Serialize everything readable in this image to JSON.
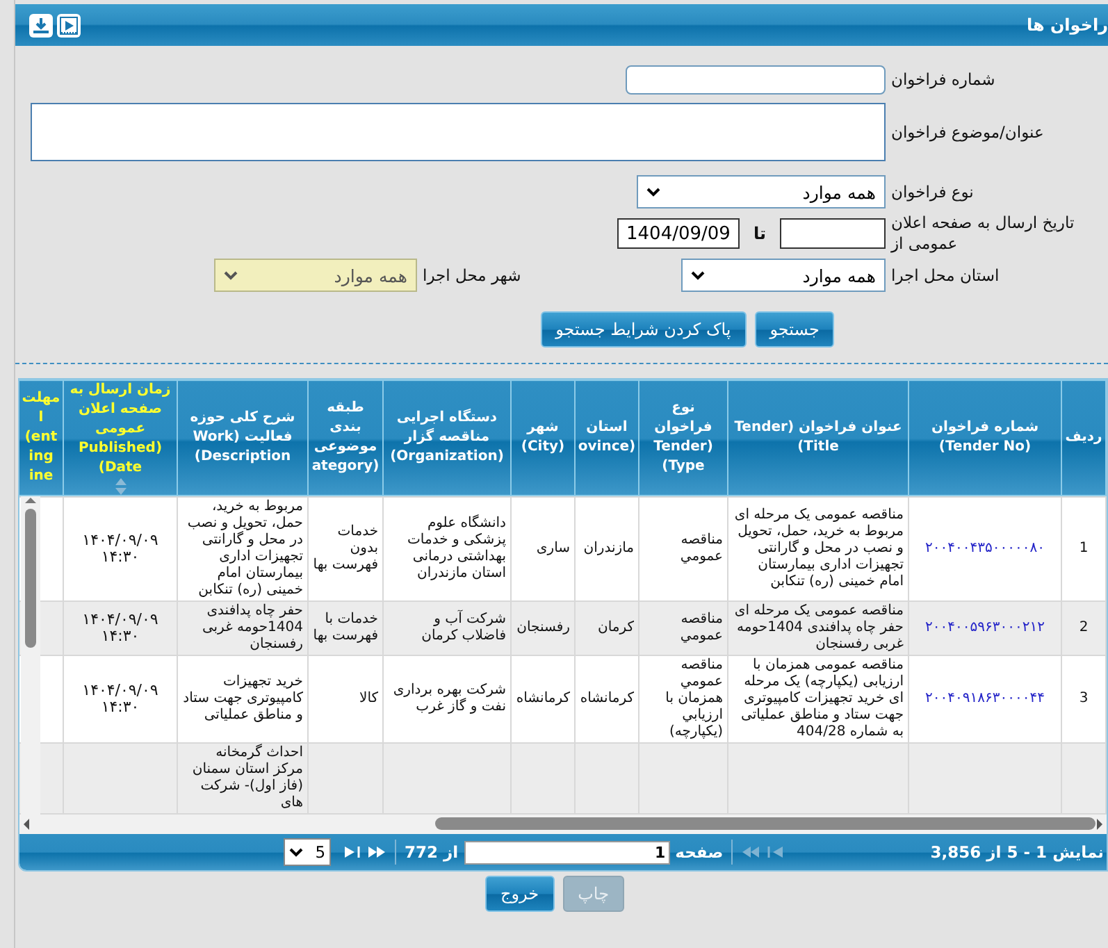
{
  "header": {
    "title": "راخوان ها",
    "icons": [
      {
        "kind": "download"
      },
      {
        "kind": "video"
      }
    ]
  },
  "form": {
    "tender_no": {
      "label": "شماره فراخوان"
    },
    "subject": {
      "label": "عنوان/موضوع فراخوان"
    },
    "type": {
      "label": "نوع فراخوان",
      "value": "همه موارد"
    },
    "date": {
      "label": "تاریخ ارسال به صفحه اعلان عمومی از",
      "to_label": "تا",
      "to_value": "1404/09/09"
    },
    "province": {
      "label": "استان محل اجرا",
      "value": "همه موارد"
    },
    "city": {
      "label": "شهر محل اجرا",
      "value": "همه موارد",
      "disabled": true
    },
    "buttons": [
      {
        "label": "جستجو"
      },
      {
        "label": "پاک کردن شرایط جستجو"
      }
    ]
  },
  "table": {
    "columns": [
      {
        "label": "ردیف",
        "highlight": false,
        "sortable": false
      },
      {
        "label": "شماره فراخوان\n(Tender No)",
        "highlight": false,
        "sortable": false
      },
      {
        "label": "عنوان فراخوان (Tender\n(Title",
        "highlight": false,
        "sortable": false
      },
      {
        "label": "نوع\nفراخوان\nTender)\n(Type",
        "highlight": false,
        "sortable": false
      },
      {
        "label": "استان\novince)",
        "highlight": false,
        "sortable": false
      },
      {
        "label": "شهر\n(City)",
        "highlight": false,
        "sortable": false
      },
      {
        "label": "دستگاه اجرایی\nمناقصه گزار\n(Organization)",
        "highlight": false,
        "sortable": false
      },
      {
        "label": "طبقه\nبندی\nموضوعی\nategory)",
        "highlight": false,
        "sortable": false
      },
      {
        "label": "شرح کلی حوزه\nفعالیت (Work\n(Description",
        "highlight": false,
        "sortable": false
      },
      {
        "label": "زمان ارسال به\nصفحه اعلان\nعمومی\nPublished)\n(Date",
        "highlight": true,
        "sortable": true
      },
      {
        "label": "مهلت\nl\n(ent\ning\nine",
        "highlight": true,
        "sortable": false
      }
    ],
    "rows": [
      {
        "cells": [
          "1",
          "۲۰۰۴۰۰۴۳۵۰۰۰۰۰۸۰",
          "مناقصه عمومی یک مرحله ای مربوط به خرید، حمل، تحویل و نصب در محل و گارانتی تجهیزات اداری بیمارستان  امام خمینی (ره) تنکابن",
          "مناقصه عمومي",
          "مازندران",
          "ساری",
          "دانشگاه علوم پزشکی و خدمات بهداشتی درمانی استان مازندران",
          "خدمات بدون فهرست بها",
          "مربوط به خرید، حمل، تحویل و نصب در محل و گارانتی تجهیزات اداری بیمارستان  امام خمینی (ره) تنکابن",
          "۱۴۰۴/۰۹/۰۹\n۱۴:۳۰"
        ]
      },
      {
        "cells": [
          "2",
          "۲۰۰۴۰۰۵۹۶۳۰۰۰۲۱۲",
          "مناقصه عمومی یک مرحله ای حفر چاه پدافندی 1404حومه غربی رفسنجان",
          "مناقصه عمومي",
          "کرمان",
          "رفسنجان",
          "شرکت آب و فاضلاب کرمان",
          "خدمات با فهرست بها",
          "حفر چاه پدافندی 1404حومه غربی رفسنجان",
          "۱۴۰۴/۰۹/۰۹\n۱۴:۳۰"
        ]
      },
      {
        "cells": [
          "3",
          "۲۰۰۴۰۹۱۸۶۳۰۰۰۰۴۴",
          "مناقصه عمومی همزمان با ارزیابی (یکپارچه) یک مرحله ای خرید تجهیزات کامپیوتری جهت ستاد و مناطق عملیاتی به شماره 404/28",
          "مناقصه عمومي همزمان با ارزيابي (يکپارچه)",
          "کرمانشاه",
          "کرمانشاه",
          "شرکت بهره برداری نفت و گاز غرب",
          "کالا",
          "خرید تجهیزات کامپیوتری جهت ستاد و مناطق عملیاتی",
          "۱۴۰۴/۰۹/۰۹\n۱۴:۳۰"
        ]
      },
      {
        "cells": [
          null,
          null,
          null,
          null,
          null,
          null,
          null,
          null,
          "احداث گرمخانه مرکز استان سمنان (فاز اول)- شرکت های",
          null
        ]
      }
    ]
  },
  "pager": {
    "summary": "نمایش 1 - 5 از 3,856",
    "page_label": "صفحه",
    "page": "1",
    "of": "از 772",
    "page_size": "5",
    "nav": [
      {
        "kind": "first",
        "disabled": true
      },
      {
        "kind": "prev",
        "disabled": true
      },
      {
        "kind": "next",
        "disabled": false
      },
      {
        "kind": "last",
        "disabled": false
      }
    ]
  },
  "footer_buttons": [
    {
      "label": "چاپ",
      "disabled": true
    },
    {
      "label": "خروج",
      "disabled": false
    }
  ]
}
